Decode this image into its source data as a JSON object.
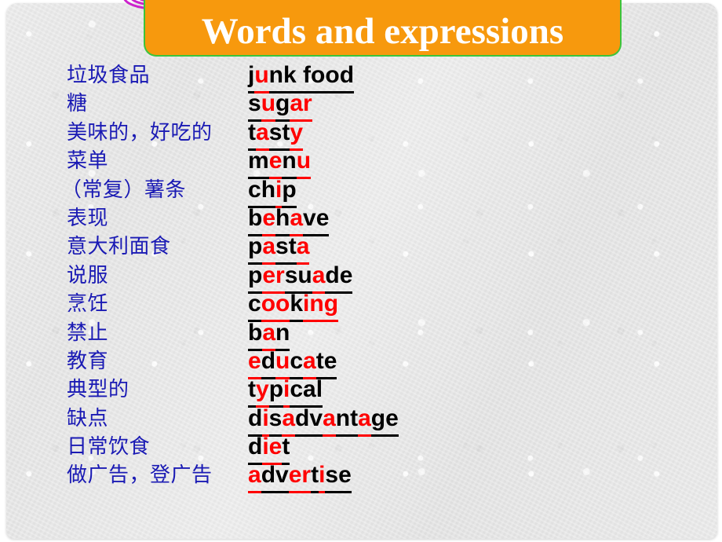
{
  "slide": {
    "title": "Words and expressions",
    "title_banner_color": "#f7990d",
    "title_banner_border_color": "#3cc43c",
    "title_text_color": "#ffffff",
    "background_color": "#e6e6e6",
    "chinese_text_color": "#1a1ab4",
    "english_text_color": "#000000",
    "highlight_color": "#ff0000"
  },
  "decorations": [
    {
      "name": "scribble-loop-left",
      "color": "#cc22cc"
    },
    {
      "name": "scribble-loop-right",
      "color": "#cc22cc"
    },
    {
      "name": "star",
      "color": "#ff1493"
    },
    {
      "name": "cloud",
      "color": "#55ddee"
    },
    {
      "name": "yellow-accent",
      "color": "#ffdd33"
    }
  ],
  "vocabulary": [
    {
      "chinese": "垃圾食品",
      "english": "junk food",
      "indent": false,
      "letters": [
        {
          "c": "j",
          "r": false
        },
        {
          "c": "u",
          "r": true
        },
        {
          "c": "n",
          "r": false
        },
        {
          "c": "k",
          "r": false
        },
        {
          "c": " ",
          "r": false
        },
        {
          "c": "f",
          "r": false
        },
        {
          "c": "o",
          "r": false
        },
        {
          "c": "o",
          "r": false
        },
        {
          "c": "d",
          "r": false
        }
      ]
    },
    {
      "chinese": "糖",
      "english": "sugar",
      "indent": false,
      "letters": [
        {
          "c": "s",
          "r": false
        },
        {
          "c": "u",
          "r": true
        },
        {
          "c": "g",
          "r": false
        },
        {
          "c": "a",
          "r": true
        },
        {
          "c": "r",
          "r": true
        }
      ]
    },
    {
      "chinese": "美味的，好吃的",
      "english": "tasty",
      "indent": false,
      "letters": [
        {
          "c": "t",
          "r": false
        },
        {
          "c": "a",
          "r": true
        },
        {
          "c": "s",
          "r": false
        },
        {
          "c": "t",
          "r": false
        },
        {
          "c": "y",
          "r": true
        }
      ]
    },
    {
      "chinese": "菜单",
      "english": "menu",
      "indent": false,
      "letters": [
        {
          "c": "m",
          "r": false
        },
        {
          "c": "e",
          "r": true
        },
        {
          "c": "n",
          "r": false
        },
        {
          "c": "u",
          "r": true
        }
      ]
    },
    {
      "chinese": "（常复）薯条",
      "english": "chip",
      "indent": true,
      "letters": [
        {
          "c": "c",
          "r": false
        },
        {
          "c": "h",
          "r": false
        },
        {
          "c": "i",
          "r": true
        },
        {
          "c": "p",
          "r": false
        }
      ]
    },
    {
      "chinese": "表现",
      "english": "behave",
      "indent": false,
      "letters": [
        {
          "c": "b",
          "r": false
        },
        {
          "c": "e",
          "r": true
        },
        {
          "c": "h",
          "r": false
        },
        {
          "c": "a",
          "r": true
        },
        {
          "c": "v",
          "r": false
        },
        {
          "c": "e",
          "r": false
        }
      ]
    },
    {
      "chinese": "意大利面食",
      "english": "pasta",
      "indent": false,
      "letters": [
        {
          "c": "p",
          "r": false
        },
        {
          "c": "a",
          "r": true
        },
        {
          "c": "s",
          "r": false
        },
        {
          "c": "t",
          "r": false
        },
        {
          "c": "a",
          "r": true
        }
      ]
    },
    {
      "chinese": "说服",
      "english": "persuade",
      "indent": false,
      "letters": [
        {
          "c": "p",
          "r": false
        },
        {
          "c": "e",
          "r": true
        },
        {
          "c": "r",
          "r": true
        },
        {
          "c": "s",
          "r": false
        },
        {
          "c": "u",
          "r": false
        },
        {
          "c": "a",
          "r": true
        },
        {
          "c": "d",
          "r": false
        },
        {
          "c": "e",
          "r": false
        }
      ]
    },
    {
      "chinese": "烹饪",
      "english": "cooking",
      "indent": false,
      "letters": [
        {
          "c": "c",
          "r": false
        },
        {
          "c": "o",
          "r": true
        },
        {
          "c": "o",
          "r": true
        },
        {
          "c": "k",
          "r": false
        },
        {
          "c": "i",
          "r": true
        },
        {
          "c": "n",
          "r": true
        },
        {
          "c": "g",
          "r": true
        }
      ]
    },
    {
      "chinese": "禁止",
      "english": "ban",
      "indent": false,
      "letters": [
        {
          "c": "b",
          "r": false
        },
        {
          "c": "a",
          "r": true
        },
        {
          "c": "n",
          "r": false
        }
      ]
    },
    {
      "chinese": "教育",
      "english": "educate",
      "indent": false,
      "letters": [
        {
          "c": "e",
          "r": true
        },
        {
          "c": "d",
          "r": false
        },
        {
          "c": "u",
          "r": true
        },
        {
          "c": "c",
          "r": false
        },
        {
          "c": "a",
          "r": true
        },
        {
          "c": "t",
          "r": false
        },
        {
          "c": "e",
          "r": false
        }
      ]
    },
    {
      "chinese": "典型的",
      "english": "typical",
      "indent": false,
      "letters": [
        {
          "c": "t",
          "r": false
        },
        {
          "c": "y",
          "r": true
        },
        {
          "c": "p",
          "r": false
        },
        {
          "c": "i",
          "r": true
        },
        {
          "c": "c",
          "r": false
        },
        {
          "c": "a",
          "r": false
        },
        {
          "c": "l",
          "r": false
        }
      ]
    },
    {
      "chinese": "缺点",
      "english": "disadvantage",
      "indent": false,
      "letters": [
        {
          "c": "d",
          "r": false
        },
        {
          "c": "i",
          "r": true
        },
        {
          "c": "s",
          "r": false
        },
        {
          "c": "a",
          "r": true
        },
        {
          "c": "d",
          "r": false
        },
        {
          "c": "v",
          "r": false
        },
        {
          "c": "a",
          "r": true
        },
        {
          "c": "n",
          "r": false
        },
        {
          "c": "t",
          "r": false
        },
        {
          "c": "a",
          "r": true
        },
        {
          "c": "g",
          "r": false
        },
        {
          "c": "e",
          "r": false
        }
      ]
    },
    {
      "chinese": "日常饮食",
      "english": "diet",
      "indent": false,
      "letters": [
        {
          "c": "d",
          "r": false
        },
        {
          "c": "i",
          "r": true
        },
        {
          "c": "e",
          "r": true
        },
        {
          "c": "t",
          "r": false
        }
      ]
    },
    {
      "chinese": "做广告，登广告",
      "english": "advertise",
      "indent": false,
      "letters": [
        {
          "c": "a",
          "r": true
        },
        {
          "c": "d",
          "r": false
        },
        {
          "c": "v",
          "r": false
        },
        {
          "c": "e",
          "r": true
        },
        {
          "c": "r",
          "r": true
        },
        {
          "c": "t",
          "r": false
        },
        {
          "c": "i",
          "r": true
        },
        {
          "c": "s",
          "r": false
        },
        {
          "c": "e",
          "r": false
        }
      ]
    }
  ]
}
